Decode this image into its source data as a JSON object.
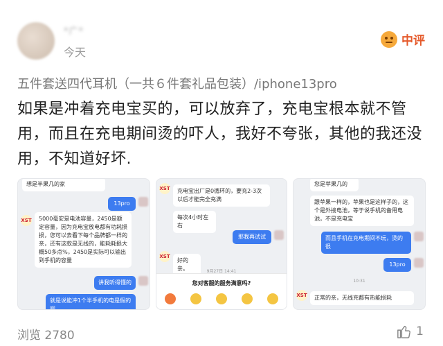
{
  "review": {
    "username": "*广*",
    "date": "今天",
    "rating": {
      "icon": "frown-face-icon",
      "label": "中评",
      "color": "#e55a2b"
    },
    "variant": "五件套送四代耳机（一共６件套礼品包装）/iphone13pro",
    "text": "如果是冲着充电宝买的，可以放弃了，充电宝根本就不管用，而且在充电期间烫的吓人，我好不夸张，其他的我还没用，不知道好坏."
  },
  "gallery": {
    "photo1": {
      "top_msg": "想是半果几的家",
      "r1": "13pro",
      "logo": "XST",
      "l1": "5000毫安是电池容量，2450是额定容量，因为充电宝放电都有功耗损损，您可以去看下每个品牌都一样的亲，还有这款是无线的，能耗耗损大概50多点%，2450是实际可以输出到手机的容量",
      "r2": "讲我听得懂的",
      "r3": "就是说能冲1个半手机的电是假的呗"
    },
    "photo2": {
      "logo1": "XST",
      "l1": "充电宝出厂是0循环的，要充2-3次以后才能完全充满",
      "l2": "每次4小时左右",
      "r1": "那我再试试",
      "logo2": "XST",
      "l3": "好的亲。",
      "time": "9月27日 14:41",
      "survey_title": "您对客服的服务满意吗?"
    },
    "photo3": {
      "l0": "您是苹果几的",
      "l1": "跟苹果一样的，苹果也是这样子的，这个是外接电池，等于说手机的备用电池，不是充电宝",
      "r1": "而且手机在充电期间不玩，烫的很",
      "r2": "13pro",
      "time": "10:31",
      "logo": "XST",
      "l2": "正常的亲，无线充都有热能损耗"
    }
  },
  "footer": {
    "views": "浏览 2780",
    "like_icon": "thumbs-up-icon",
    "likes": "1"
  }
}
